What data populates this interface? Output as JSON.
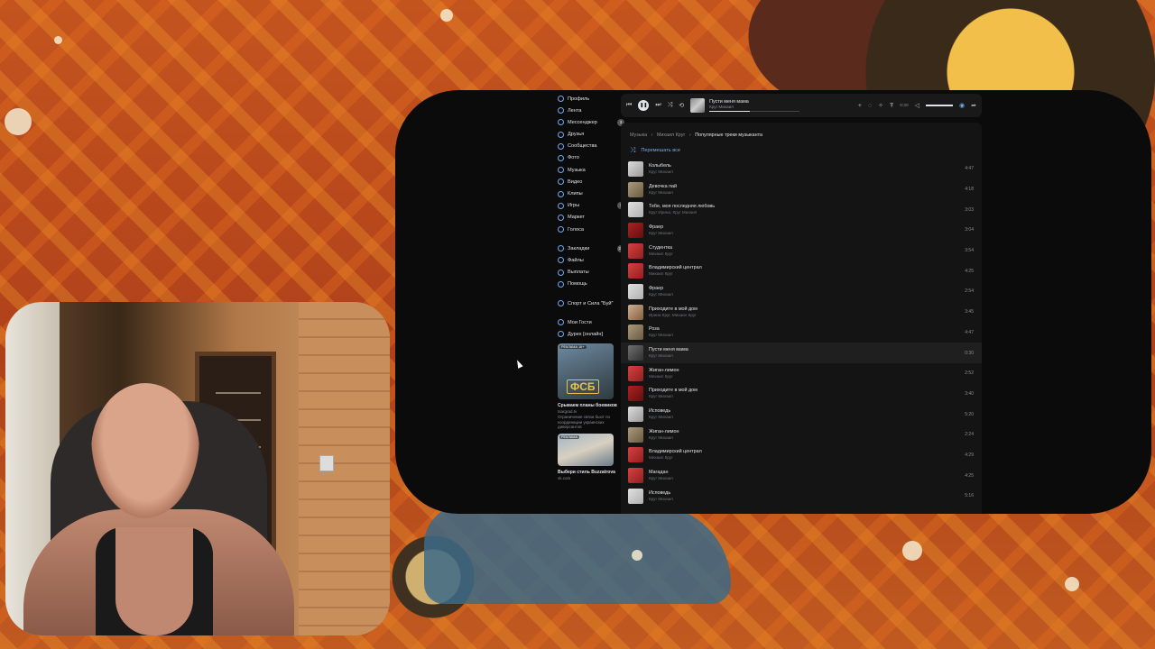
{
  "sidebar": {
    "items": [
      {
        "label": "Профиль",
        "icon": "user-icon"
      },
      {
        "label": "Лента",
        "icon": "news-icon"
      },
      {
        "label": "Мессенджер",
        "icon": "message-icon",
        "badge": "3"
      },
      {
        "label": "Друзья",
        "icon": "friends-icon"
      },
      {
        "label": "Сообщества",
        "icon": "groups-icon"
      },
      {
        "label": "Фото",
        "icon": "photo-icon"
      },
      {
        "label": "Музыка",
        "icon": "music-icon"
      },
      {
        "label": "Видео",
        "icon": "video-icon"
      },
      {
        "label": "Клипы",
        "icon": "clips-icon"
      },
      {
        "label": "Игры",
        "icon": "games-icon",
        "badge": "3"
      },
      {
        "label": "Маркет",
        "icon": "market-icon"
      },
      {
        "label": "Голоса",
        "icon": "votes-icon"
      }
    ],
    "items2": [
      {
        "label": "Закладки",
        "icon": "bookmark-icon",
        "badge": "24"
      },
      {
        "label": "Файлы",
        "icon": "files-icon"
      },
      {
        "label": "Выплаты",
        "icon": "payments-icon"
      },
      {
        "label": "Помощь",
        "icon": "help-icon"
      }
    ],
    "items3": [
      {
        "label": "Спорт и Сила \"Буй\"",
        "icon": "community-icon"
      }
    ],
    "items4": [
      {
        "label": "Мои Гости",
        "icon": "app-icon"
      },
      {
        "label": "Дурех [онлайн]",
        "icon": "app-icon"
      }
    ],
    "ads": [
      {
        "tag": "РЕКЛАМА 16+",
        "logo": "ФСБ",
        "title": "Срываем планы боевиков",
        "domain": "tsargrad.tv",
        "desc": "Ограничение связи бьют по координации украинских диверсантов"
      },
      {
        "tag": "РЕКЛАМА",
        "title": "Выбери стиль Buzzatrova",
        "domain": "vk.com"
      }
    ]
  },
  "player": {
    "now_title": "Пусти меня мама",
    "now_artist": "Круг Михаил",
    "progress": 0.45,
    "time": "0:30",
    "icons": [
      "prev-icon",
      "pause-icon",
      "next-icon",
      "repeat-icon",
      "shuffle-icon",
      "add-icon",
      "lyrics-icon",
      "sparkle-icon",
      "text-icon",
      "volume-icon",
      "broadcast-icon",
      "share-icon"
    ]
  },
  "breadcrumb": {
    "items": [
      "Музыка",
      "Михаил Круг",
      "Популярные треки музыканта"
    ]
  },
  "shuffle_all": "Перемешать все",
  "tracks": [
    {
      "title": "Колыбель",
      "artist": "Круг Михаил",
      "duration": "4:47",
      "cover": "c0"
    },
    {
      "title": "Девочка пай",
      "artist": "Круг Михаил",
      "duration": "4:18",
      "cover": "c1"
    },
    {
      "title": "Тебе, моя последняя любовь",
      "artist": "Круг Ирина, Круг Михаил",
      "duration": "3:03",
      "cover": "c2"
    },
    {
      "title": "Фраер",
      "artist": "Круг Михаил",
      "duration": "3:04",
      "cover": "c3"
    },
    {
      "title": "Студентка",
      "artist": "Михаил Круг",
      "duration": "3:54",
      "cover": "c4"
    },
    {
      "title": "Владимирский централ",
      "artist": "Михаил Круг",
      "duration": "4:25",
      "cover": "c4"
    },
    {
      "title": "Фраер",
      "artist": "Круг Михаил",
      "duration": "2:54",
      "cover": "c2"
    },
    {
      "title": "Приходите в мой дом",
      "artist": "Ирина Круг, Михаил Круг",
      "duration": "3:45",
      "cover": "c5"
    },
    {
      "title": "Роза",
      "artist": "Круг Михаил",
      "duration": "4:47",
      "cover": "c1"
    },
    {
      "title": "Пусти меня мама",
      "artist": "Круг Михаил",
      "duration": "0:30",
      "cover": "c6",
      "active": true
    },
    {
      "title": "Жиган-лимон",
      "artist": "Михаил Круг",
      "duration": "2:52",
      "cover": "c4"
    },
    {
      "title": "Приходите в мой дом",
      "artist": "Круг Михаил",
      "duration": "3:40",
      "cover": "c3"
    },
    {
      "title": "Исповедь",
      "artist": "Круг Михаил",
      "duration": "5:20",
      "cover": "c0"
    },
    {
      "title": "Жиган-лимон",
      "artist": "Круг Михаил",
      "duration": "2:24",
      "cover": "c1"
    },
    {
      "title": "Владимирский централ",
      "artist": "Михаил Круг",
      "duration": "4:29",
      "cover": "c4"
    },
    {
      "title": "Магадан",
      "artist": "Круг Михаил",
      "duration": "4:25",
      "cover": "c4"
    },
    {
      "title": "Исповедь",
      "artist": "Круг Михаил",
      "duration": "5:16",
      "cover": "c2"
    }
  ],
  "colors": {
    "accent": "#71aaeb",
    "panel": "#141414",
    "text": "#e1e3e6"
  }
}
